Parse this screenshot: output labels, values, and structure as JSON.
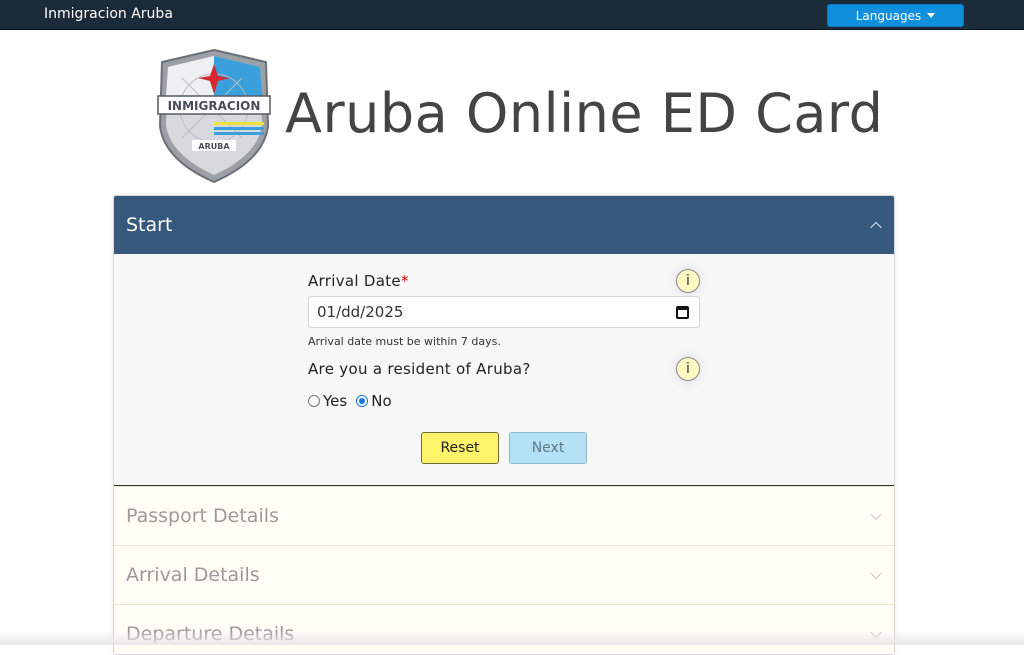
{
  "navbar": {
    "brand": "Inmigracion Aruba",
    "languages_button": "Languages"
  },
  "header": {
    "logo_text": "INMIGRACION",
    "logo_subtext": "ARUBA",
    "title": "Aruba Online ED Card"
  },
  "accordion": {
    "start": {
      "title": "Start",
      "arrival_date": {
        "label": "Arrival Date",
        "required_mark": "*",
        "value": "01/dd/2025",
        "helper": "Arrival date must be within 7 days."
      },
      "resident": {
        "label": "Are you a resident of Aruba?",
        "options": [
          "Yes",
          "No"
        ],
        "selected": "No"
      },
      "info_glyph": "i",
      "reset_label": "Reset",
      "next_label": "Next"
    },
    "sections": [
      {
        "title": "Passport Details"
      },
      {
        "title": "Arrival Details"
      },
      {
        "title": "Departure Details"
      }
    ]
  },
  "colors": {
    "navbar": "#1c2b3a",
    "languages_button": "#0f8fdc",
    "active_section": "#36587c",
    "reset_button": "#fff46a",
    "next_button": "#b4e2f4",
    "info_icon": "#fff9c4"
  },
  "icons": {
    "dropdown": "caret-down-icon",
    "section_open": "chevron-up-icon",
    "section_closed": "chevron-down-icon",
    "info": "info-icon",
    "calendar": "calendar-icon"
  }
}
